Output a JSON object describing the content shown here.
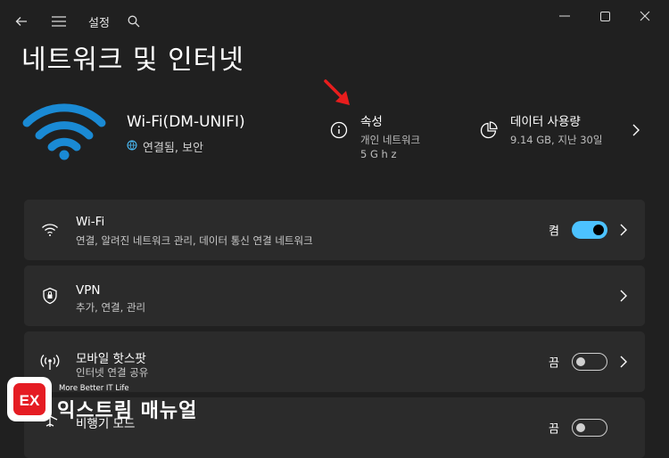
{
  "window": {
    "title": "설정"
  },
  "page": {
    "title": "네트워크 및 인터넷"
  },
  "header": {
    "wifi_name": "Wi-Fi(DM-UNIFI)",
    "wifi_status": "연결됨, 보안",
    "properties": {
      "title": "속성",
      "line1": "개인 네트워크",
      "line2": "5 G h z"
    },
    "data_usage": {
      "title": "데이터 사용량",
      "sub": "9.14 GB, 지난 30일"
    }
  },
  "cards": [
    {
      "title": "Wi-Fi",
      "sub": "연결, 알려진 네트워크 관리, 데이터 통신 연결 네트워크",
      "state": "켬",
      "toggle": "on",
      "icon": "wifi-icon"
    },
    {
      "title": "VPN",
      "sub": "추가, 연결, 관리",
      "icon": "shield-icon"
    },
    {
      "title": "모바일 핫스팟",
      "sub": "인터넷 연결 공유",
      "state": "끔",
      "toggle": "off",
      "icon": "hotspot-icon"
    },
    {
      "title": "비행기 모드",
      "state": "끔",
      "toggle": "off",
      "icon": "airplane-icon"
    }
  ],
  "watermark": {
    "tagline": "More Better IT Life",
    "name": "익스트림 매뉴얼",
    "logo_text": "EX"
  },
  "colors": {
    "background": "#202020",
    "card": "#2b2b2b",
    "accent": "#4cc2ff",
    "wifi_hero": "#1a8ad4",
    "annotation_arrow": "#e81d1d"
  }
}
